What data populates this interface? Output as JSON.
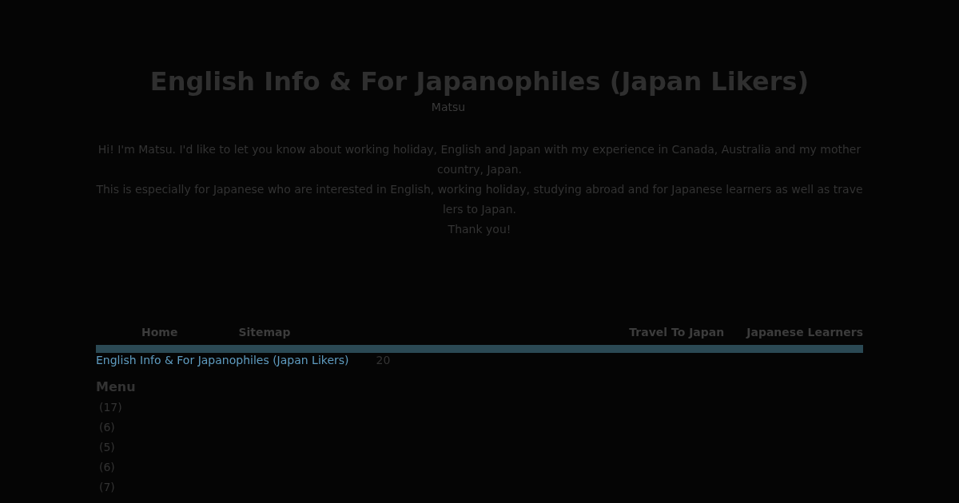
{
  "header": {
    "title": "English Info & For Japanophiles (Japan Likers)",
    "author": "Matsu",
    "intro": [
      "Hi! I'm Matsu. I'd like to let you know about working holiday, English and Japan with my experience in Canada, Australia and my mother country, Japan.",
      "This is especially for Japanese who are interested in English, working holiday, studying abroad and for Japanese learners as well as trave lers to Japan.",
      "Thank you!"
    ]
  },
  "nav": [
    "Home",
    "Sitemap",
    "Travel To Japan",
    "Japanese Learners"
  ],
  "breadcrumb": {
    "link": "English Info & For Japanophiles (Japan Likers)",
    "count": "20"
  },
  "menu": {
    "title": "Menu",
    "items": [
      {
        "count": "(17)"
      },
      {
        "count": "(6)"
      },
      {
        "count": "(5)"
      },
      {
        "count": "(6)"
      },
      {
        "count": "(7)"
      }
    ]
  }
}
